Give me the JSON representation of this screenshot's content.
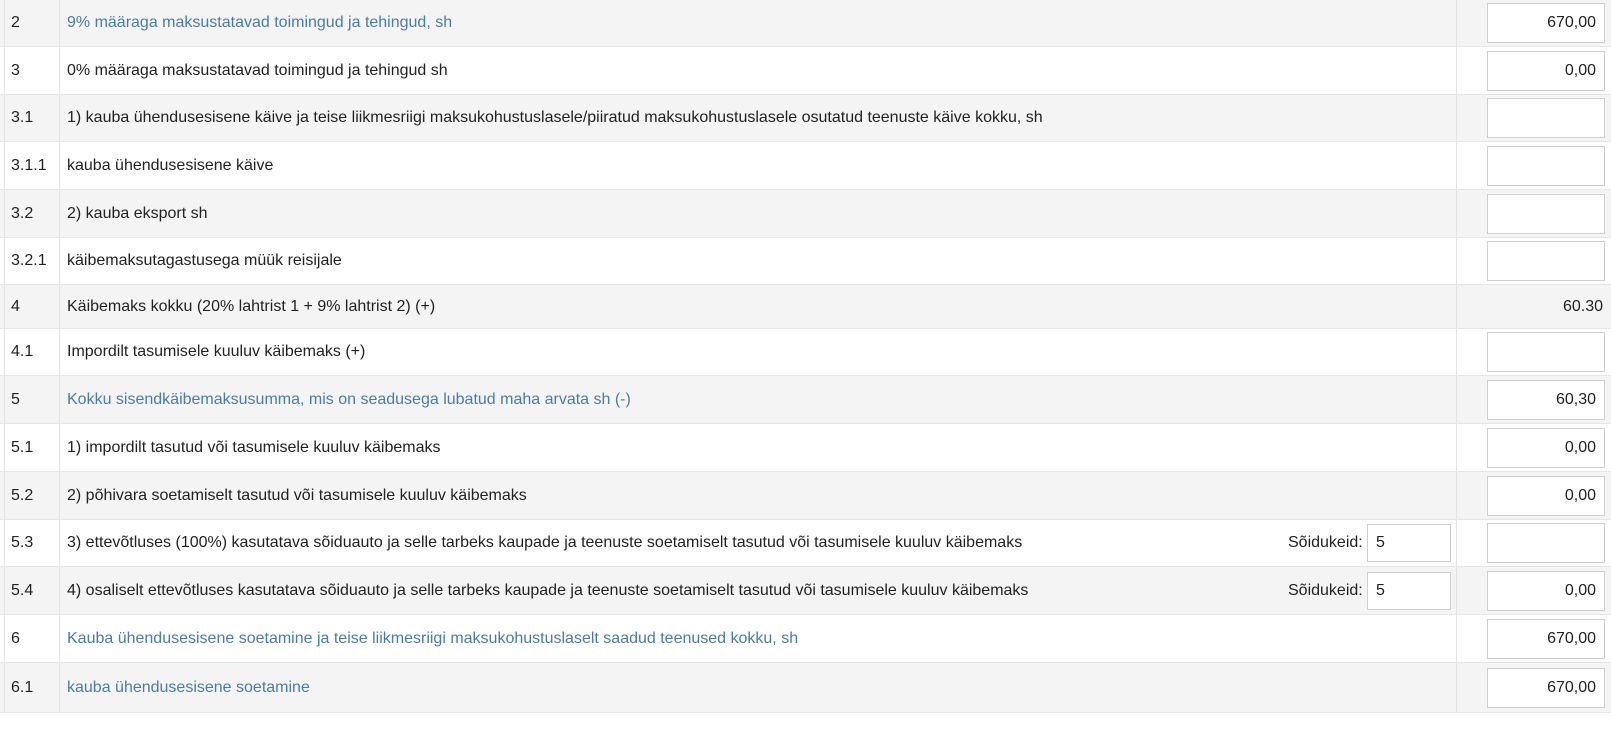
{
  "rows": [
    {
      "code": "2",
      "label": "9% määraga maksustatavad toimingud ja tehingud, sh",
      "link": true,
      "value": "670,00",
      "field": "input"
    },
    {
      "code": "3",
      "label": "0% määraga maksustatavad toimingud ja tehingud sh",
      "link": false,
      "value": "0,00",
      "field": "input"
    },
    {
      "code": "3.1",
      "label": "1) kauba ühendusesisene käive ja teise liikmesriigi maksukohustuslasele/piiratud maksukohustuslasele osutatud teenuste käive kokku, sh",
      "link": false,
      "value": "",
      "field": "input"
    },
    {
      "code": "3.1.1",
      "label": "kauba ühendusesisene käive",
      "link": false,
      "value": "",
      "field": "input"
    },
    {
      "code": "3.2",
      "label": "2) kauba eksport sh",
      "link": false,
      "value": "",
      "field": "input"
    },
    {
      "code": "3.2.1",
      "label": "käibemaksutagastusega müük reisijale",
      "link": false,
      "value": "",
      "field": "input"
    },
    {
      "code": "4",
      "label": "Käibemaks kokku (20% lahtrist 1 + 9% lahtrist 2) (+)",
      "link": false,
      "value": "60.30",
      "field": "static"
    },
    {
      "code": "4.1",
      "label": "Impordilt tasumisele kuuluv käibemaks (+)",
      "link": false,
      "value": "",
      "field": "input"
    },
    {
      "code": "5",
      "label": "Kokku sisendkäibemaksusumma, mis on seadusega lubatud maha arvata sh (-)",
      "link": true,
      "value": "60,30",
      "field": "input"
    },
    {
      "code": "5.1",
      "label": "1) impordilt tasutud või tasumisele kuuluv käibemaks",
      "link": false,
      "value": "0,00",
      "field": "input"
    },
    {
      "code": "5.2",
      "label": "2) põhivara soetamiselt tasutud või tasumisele kuuluv käibemaks",
      "link": false,
      "value": "0,00",
      "field": "input"
    },
    {
      "code": "5.3",
      "label": "3) ettevõtluses (100%) kasutatava sõiduauto ja selle tarbeks kaupade ja teenuste soetamiselt tasutud või tasumisele kuuluv käibemaks",
      "link": false,
      "value": "",
      "field": "input",
      "vehicles_label": "Sõidukeid:",
      "vehicles": "5"
    },
    {
      "code": "5.4",
      "label": "4) osaliselt ettevõtluses kasutatava sõiduauto ja selle tarbeks kaupade ja teenuste soetamiselt tasutud või tasumisele kuuluv käibemaks",
      "link": false,
      "value": "0,00",
      "field": "input",
      "vehicles_label": "Sõidukeid:",
      "vehicles": "5"
    },
    {
      "code": "6",
      "label": "Kauba ühendusesisene soetamine ja teise liikmesriigi maksukohustuslaselt saadud teenused kokku, sh",
      "link": true,
      "value": "670,00",
      "field": "input"
    },
    {
      "code": "6.1",
      "label": "kauba ühendusesisene soetamine",
      "link": true,
      "value": "670,00",
      "field": "input"
    }
  ]
}
